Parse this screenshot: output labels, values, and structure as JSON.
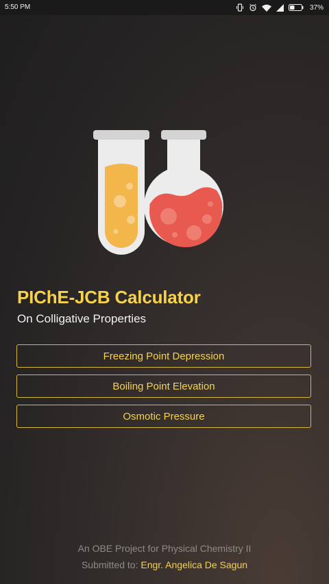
{
  "status_bar": {
    "time": "5:50 PM",
    "battery_percent": "37%",
    "icons": [
      "vibrate-icon",
      "alarm-icon",
      "wifi-icon",
      "signal-icon",
      "battery-icon"
    ]
  },
  "app": {
    "title": "PIChE-JCB Calculator",
    "subtitle": "On Colligative Properties",
    "logo_icon": "test-tube-and-flask-icon"
  },
  "menu": {
    "items": [
      {
        "label": "Freezing Point Depression"
      },
      {
        "label": "Boiling Point Elevation"
      },
      {
        "label": "Osmotic Pressure"
      }
    ]
  },
  "footer": {
    "line1": "An OBE Project for Physical Chemistry II",
    "submitted_prefix": "Submitted to:",
    "submitted_name": "Engr. Angelica De Sagun"
  },
  "colors": {
    "accent": "#f7d24a",
    "button_border": "#d8b93c",
    "tube_liquid": "#f2b64a",
    "flask_liquid": "#e85a4f",
    "glass": "#ececec"
  }
}
